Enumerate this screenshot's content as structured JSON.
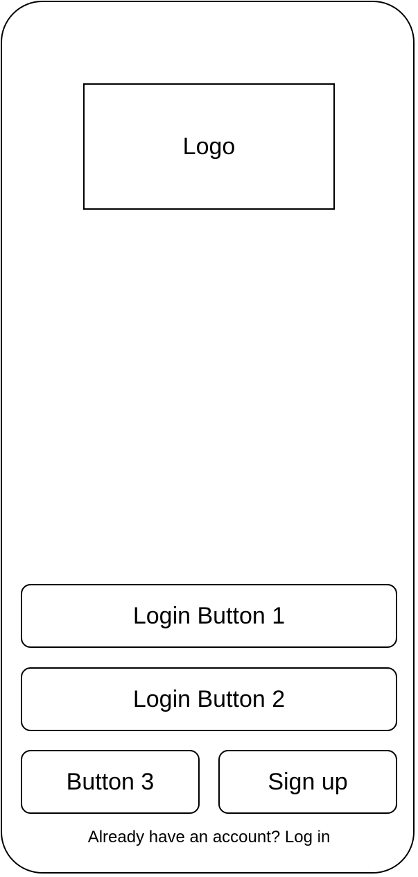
{
  "logo": {
    "label": "Logo"
  },
  "buttons": {
    "login_1": "Login Button 1",
    "login_2": "Login Button 2",
    "button_3": "Button 3",
    "sign_up": "Sign up"
  },
  "footer": {
    "login_prompt": "Already have an account? Log in"
  },
  "colors": {
    "border": "#000000",
    "background": "#ffffff",
    "text": "#000000"
  }
}
